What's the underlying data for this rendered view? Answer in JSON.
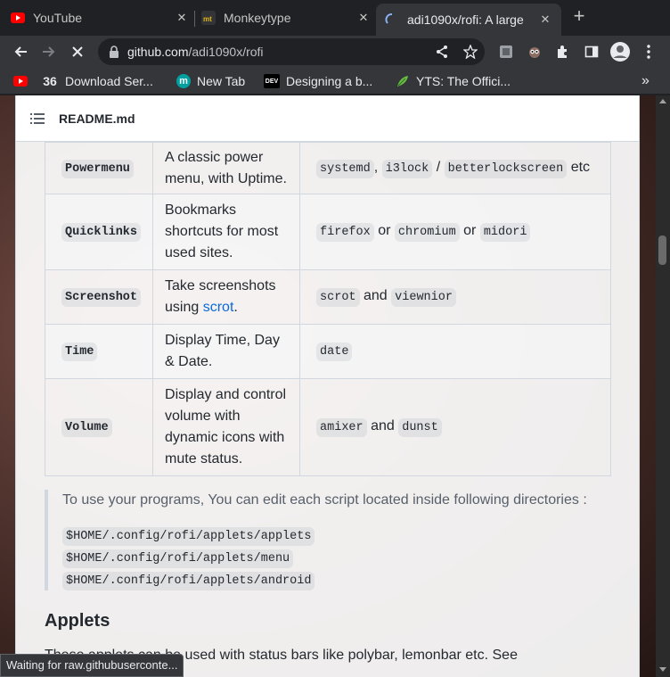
{
  "browser": {
    "tabs": [
      {
        "title": "YouTube",
        "icon": "youtube-icon",
        "active": false
      },
      {
        "title": "Monkeytype",
        "icon": "monkeytype-icon",
        "active": false
      },
      {
        "title": "adi1090x/rofi: A large",
        "icon": "loading-spinner-icon",
        "active": true
      }
    ],
    "new_tab_icon": "plus-icon",
    "url_host": "github.com",
    "url_path": "/adi1090x/rofi",
    "bookmarks": [
      {
        "label": "Download Ser...",
        "icon": "36-icon",
        "icon_text": "36"
      },
      {
        "label": "New Tab",
        "icon": "m-circle-icon",
        "icon_text": "m"
      },
      {
        "label": "Designing a b...",
        "icon": "dev-icon",
        "icon_text": "DEV"
      },
      {
        "label": "YTS: The Offici...",
        "icon": "yts-leaf-icon",
        "icon_text": ""
      }
    ],
    "status_text": "Waiting for raw.githubuserconte..."
  },
  "readme": {
    "filename": "README.md",
    "rows": [
      {
        "name": "Powermenu",
        "desc": "A classic power menu, with Uptime.",
        "deps": [
          {
            "code": "systemd"
          },
          {
            "text": ","
          },
          {
            "code": "i3lock"
          },
          {
            "text": "/"
          },
          {
            "code": "betterlockscreen"
          },
          {
            "text": "etc"
          }
        ]
      },
      {
        "name": "Quicklinks",
        "desc": "Bookmarks shortcuts for most used sites.",
        "deps": [
          {
            "code": "firefox"
          },
          {
            "text": "or"
          },
          {
            "code": "chromium"
          },
          {
            "text": "or"
          },
          {
            "code": "midori"
          }
        ]
      },
      {
        "name": "Screenshot",
        "desc_pre": "Take screenshots using ",
        "desc_link": "scrot",
        "desc_post": ".",
        "deps": [
          {
            "code": "scrot"
          },
          {
            "text": "and"
          },
          {
            "code": "viewnior"
          }
        ]
      },
      {
        "name": "Time",
        "desc": "Display Time, Day & Date.",
        "deps": [
          {
            "code": "date"
          }
        ]
      },
      {
        "name": "Volume",
        "desc": "Display and control volume with dynamic icons with mute status.",
        "deps": [
          {
            "code": "amixer"
          },
          {
            "text": "and"
          },
          {
            "code": "dunst"
          }
        ]
      }
    ],
    "quote_text": "To use your programs, You can edit each script located inside following directories :",
    "quote_paths": [
      "$HOME/.config/rofi/applets/applets",
      "$HOME/.config/rofi/applets/menu",
      "$HOME/.config/rofi/applets/android"
    ],
    "heading": "Applets",
    "bottom_text": "These applets can be used with status bars like polybar, lemonbar etc. See"
  },
  "colors": {
    "chrome_dark": "#202124",
    "chrome_toolbar": "#35363a",
    "link": "#0969da",
    "youtube_red": "#ff0000",
    "loading_blue": "#8ab4f8"
  }
}
